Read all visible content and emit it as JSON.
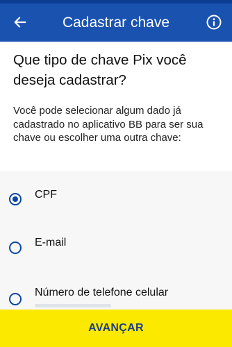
{
  "header": {
    "title": "Cadastrar chave",
    "back_icon": "arrow-left-icon",
    "info_icon": "info-icon"
  },
  "content": {
    "question": "Que tipo de chave Pix você deseja cadastrar?",
    "description": "Você pode selecionar algum dado já cadastrado no aplicativo BB para ser sua chave ou escolher uma outra chave:"
  },
  "options": [
    {
      "label": "CPF",
      "selected": true
    },
    {
      "label": "E-mail",
      "selected": false
    },
    {
      "label": "Número de telefone celular",
      "selected": false
    }
  ],
  "footer": {
    "advance_label": "AVANÇAR"
  },
  "colors": {
    "header_blue": "#1a52b0",
    "status_blue": "#0b3d91",
    "accent_yellow": "#fbe900",
    "radio_blue": "#0d47a1",
    "button_text": "#1a3c8f"
  }
}
